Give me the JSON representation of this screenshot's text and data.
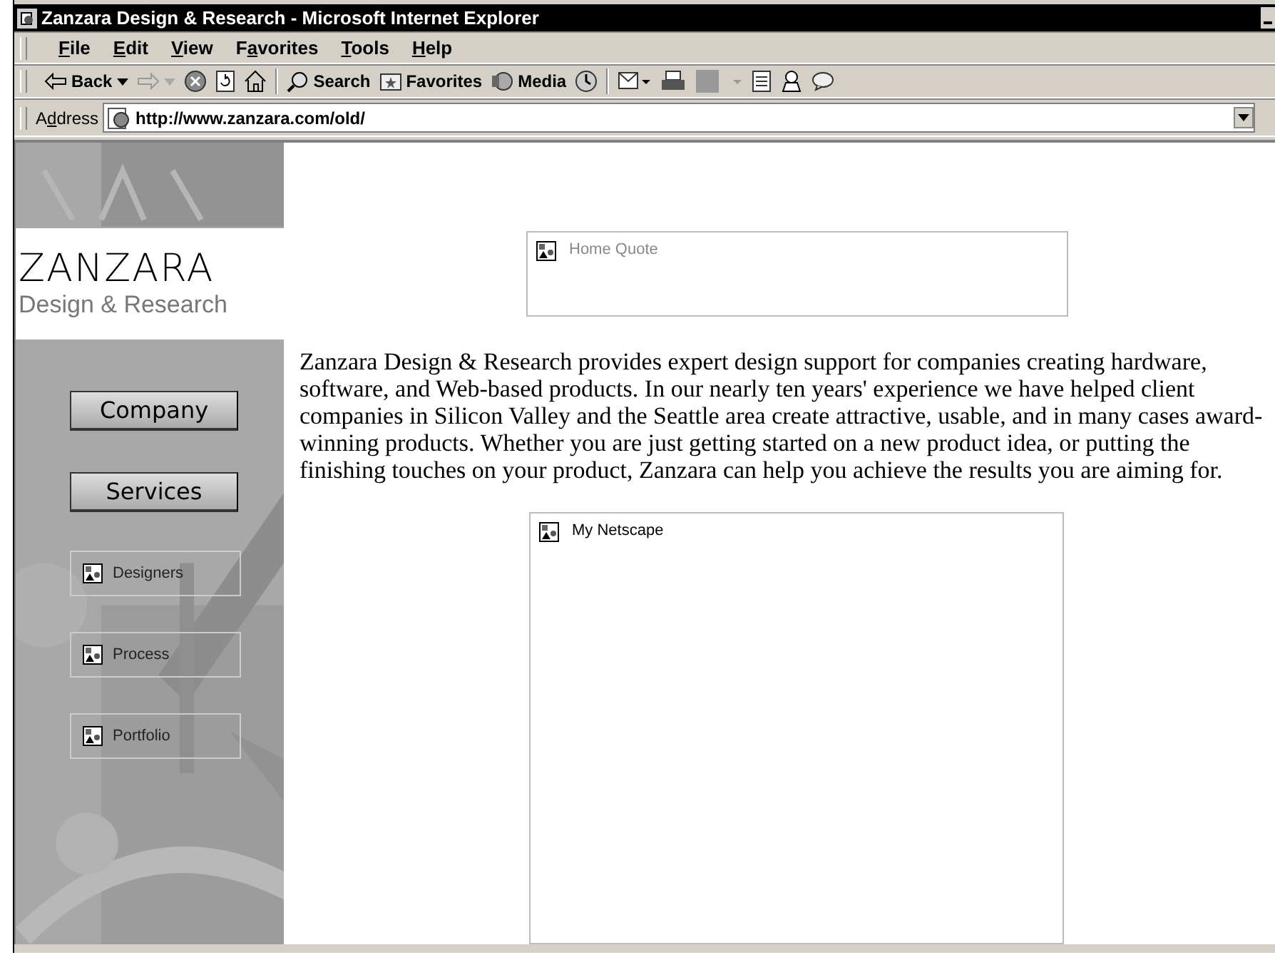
{
  "window": {
    "title": "Zanzara Design & Research - Microsoft Internet Explorer"
  },
  "menu": [
    {
      "key": "F",
      "post": "ile"
    },
    {
      "key": "E",
      "post": "dit"
    },
    {
      "key": "V",
      "post": "iew"
    },
    {
      "pre": "F",
      "key": "a",
      "post": "vorites"
    },
    {
      "key": "T",
      "post": "ools"
    },
    {
      "key": "H",
      "post": "elp"
    }
  ],
  "toolbar": [
    {
      "kind": "back",
      "label": "Back"
    },
    {
      "kind": "forward"
    },
    {
      "kind": "stop"
    },
    {
      "kind": "refresh"
    },
    {
      "kind": "home"
    },
    {
      "kind": "separator"
    },
    {
      "kind": "search",
      "label": "Search"
    },
    {
      "kind": "favorites",
      "label": "Favorites"
    },
    {
      "kind": "media",
      "label": "Media"
    },
    {
      "kind": "history"
    },
    {
      "kind": "separator"
    },
    {
      "kind": "mail"
    },
    {
      "kind": "print"
    },
    {
      "kind": "edit"
    },
    {
      "kind": "discuss"
    },
    {
      "kind": "research"
    },
    {
      "kind": "messenger"
    }
  ],
  "address": {
    "pre": "A",
    "key": "d",
    "post": "dress",
    "url": "http://www.zanzara.com/old/"
  },
  "sidebar": {
    "logo": "ZANZARA",
    "tagline": "Design & Research",
    "buttons": [
      "Company",
      "Services"
    ],
    "links": [
      "Designers",
      "Process",
      "Portfolio"
    ]
  },
  "quote_box": {
    "alt": "Home Quote",
    "dimmed": true
  },
  "paragraph": "Zanzara Design & Research provides expert design support for companies creating hardware, software, and Web-based products. In our nearly ten years' experience we have helped client companies in Silicon Valley and the Seattle area create attractive, usable, and in many cases award-winning products. Whether you are just getting started on a new product idea, or putting the finishing touches on your product, Zanzara can help you achieve the results you are aiming for.",
  "netscape_box": {
    "alt": "My Netscape",
    "dimmed": false
  }
}
